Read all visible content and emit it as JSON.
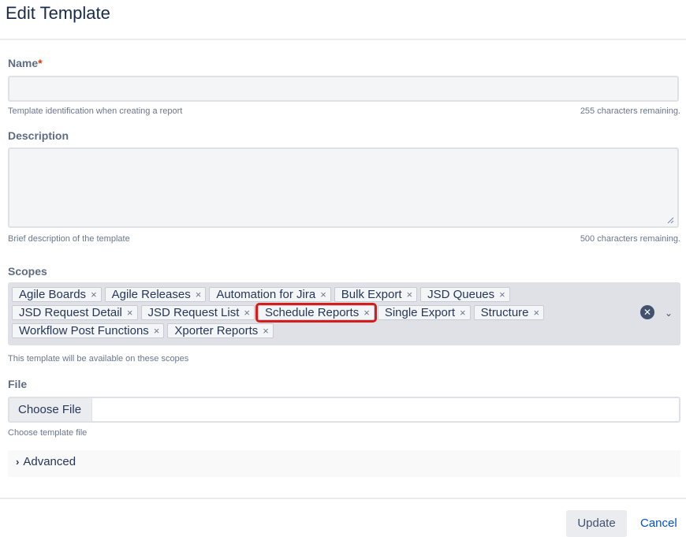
{
  "header": {
    "title": "Edit Template"
  },
  "form": {
    "name": {
      "label": "Name",
      "required_marker": "*",
      "value": "",
      "help": "Template identification when creating a report",
      "remaining": "255 characters remaining."
    },
    "description": {
      "label": "Description",
      "value": "",
      "help": "Brief description of the template",
      "remaining": "500 characters remaining."
    },
    "scopes": {
      "label": "Scopes",
      "tags": [
        "Agile Boards",
        "Agile Releases",
        "Automation for Jira",
        "Bulk Export",
        "JSD Queues",
        "JSD Request Detail",
        "JSD Request List",
        "Schedule Reports",
        "Single Export",
        "Structure",
        "Workflow Post Functions",
        "Xporter Reports"
      ],
      "remove_glyph": "×",
      "highlighted_tag": "Schedule Reports",
      "help": "This template will be available on these scopes"
    },
    "file": {
      "label": "File",
      "button_label": "Choose File",
      "help": "Choose template file"
    },
    "advanced": {
      "label": "Advanced"
    }
  },
  "footer": {
    "update_label": "Update",
    "cancel_label": "Cancel"
  },
  "colors": {
    "highlight": "#d61c1c",
    "link": "#0052cc",
    "required": "#de350b"
  }
}
